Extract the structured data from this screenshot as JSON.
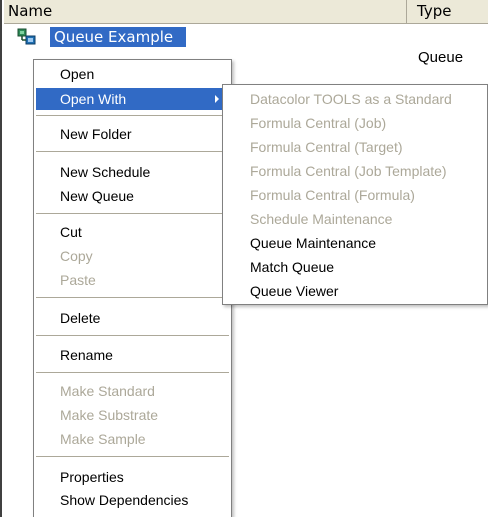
{
  "columns": {
    "name": "Name",
    "type": "Type"
  },
  "row": {
    "name": "Queue Example",
    "type": "Queue",
    "icon": "queue-icon"
  },
  "context_menu": {
    "items": [
      {
        "label": "Open",
        "disabled": false
      },
      {
        "label": "Open With",
        "disabled": false,
        "highlighted": true,
        "submenu": true
      },
      {
        "label": "New Folder",
        "disabled": false
      },
      {
        "label": "New Schedule",
        "disabled": false
      },
      {
        "label": "New Queue",
        "disabled": false
      },
      {
        "label": "Cut",
        "disabled": false
      },
      {
        "label": "Copy",
        "disabled": true
      },
      {
        "label": "Paste",
        "disabled": true
      },
      {
        "label": "Delete",
        "disabled": false
      },
      {
        "label": "Rename",
        "disabled": false
      },
      {
        "label": "Make Standard",
        "disabled": true
      },
      {
        "label": "Make Substrate",
        "disabled": true
      },
      {
        "label": "Make Sample",
        "disabled": true
      },
      {
        "label": "Properties",
        "disabled": false
      },
      {
        "label": "Show Dependencies",
        "disabled": false
      }
    ]
  },
  "open_with_submenu": {
    "items": [
      {
        "label": "Datacolor TOOLS as a Standard",
        "disabled": true
      },
      {
        "label": "Formula Central (Job)",
        "disabled": true
      },
      {
        "label": "Formula Central (Target)",
        "disabled": true
      },
      {
        "label": "Formula Central (Job Template)",
        "disabled": true
      },
      {
        "label": "Formula Central (Formula)",
        "disabled": true
      },
      {
        "label": "Schedule Maintenance",
        "disabled": true
      },
      {
        "label": "Queue Maintenance",
        "disabled": false
      },
      {
        "label": "Match Queue",
        "disabled": false
      },
      {
        "label": "Queue Viewer",
        "disabled": false
      }
    ]
  },
  "colors": {
    "selection": "#316ac5",
    "disabled_text": "#aca899",
    "header_bg": "#ece9d8"
  }
}
